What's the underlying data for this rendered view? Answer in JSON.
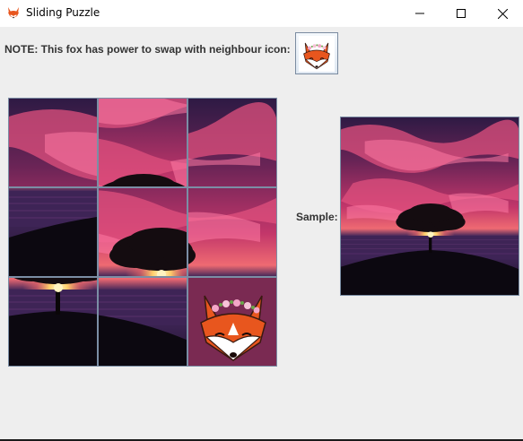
{
  "window": {
    "title": "Sliding Puzzle",
    "icon": "fox-icon"
  },
  "controls": {
    "minimize_icon": "minimize-icon",
    "maximize_icon": "maximize-icon",
    "close_icon": "close-icon"
  },
  "note": {
    "text": "NOTE: This fox has power to swap with neighbour icon:",
    "button_icon": "fox-icon"
  },
  "puzzle": {
    "rows": 3,
    "cols": 3,
    "tile_order": [
      1,
      2,
      3,
      4,
      8,
      6,
      7,
      5,
      9
    ],
    "fox_tile": 9
  },
  "sample": {
    "label": "Sample:"
  },
  "colors": {
    "sky_top": "#3a1e4a",
    "sky_mid": "#b8346a",
    "cloud": "#e85a8a",
    "sea": "#4a2a5a",
    "ground": "#0e0a10",
    "sun": "#ffdc8a",
    "fox_orange": "#e8561e"
  }
}
